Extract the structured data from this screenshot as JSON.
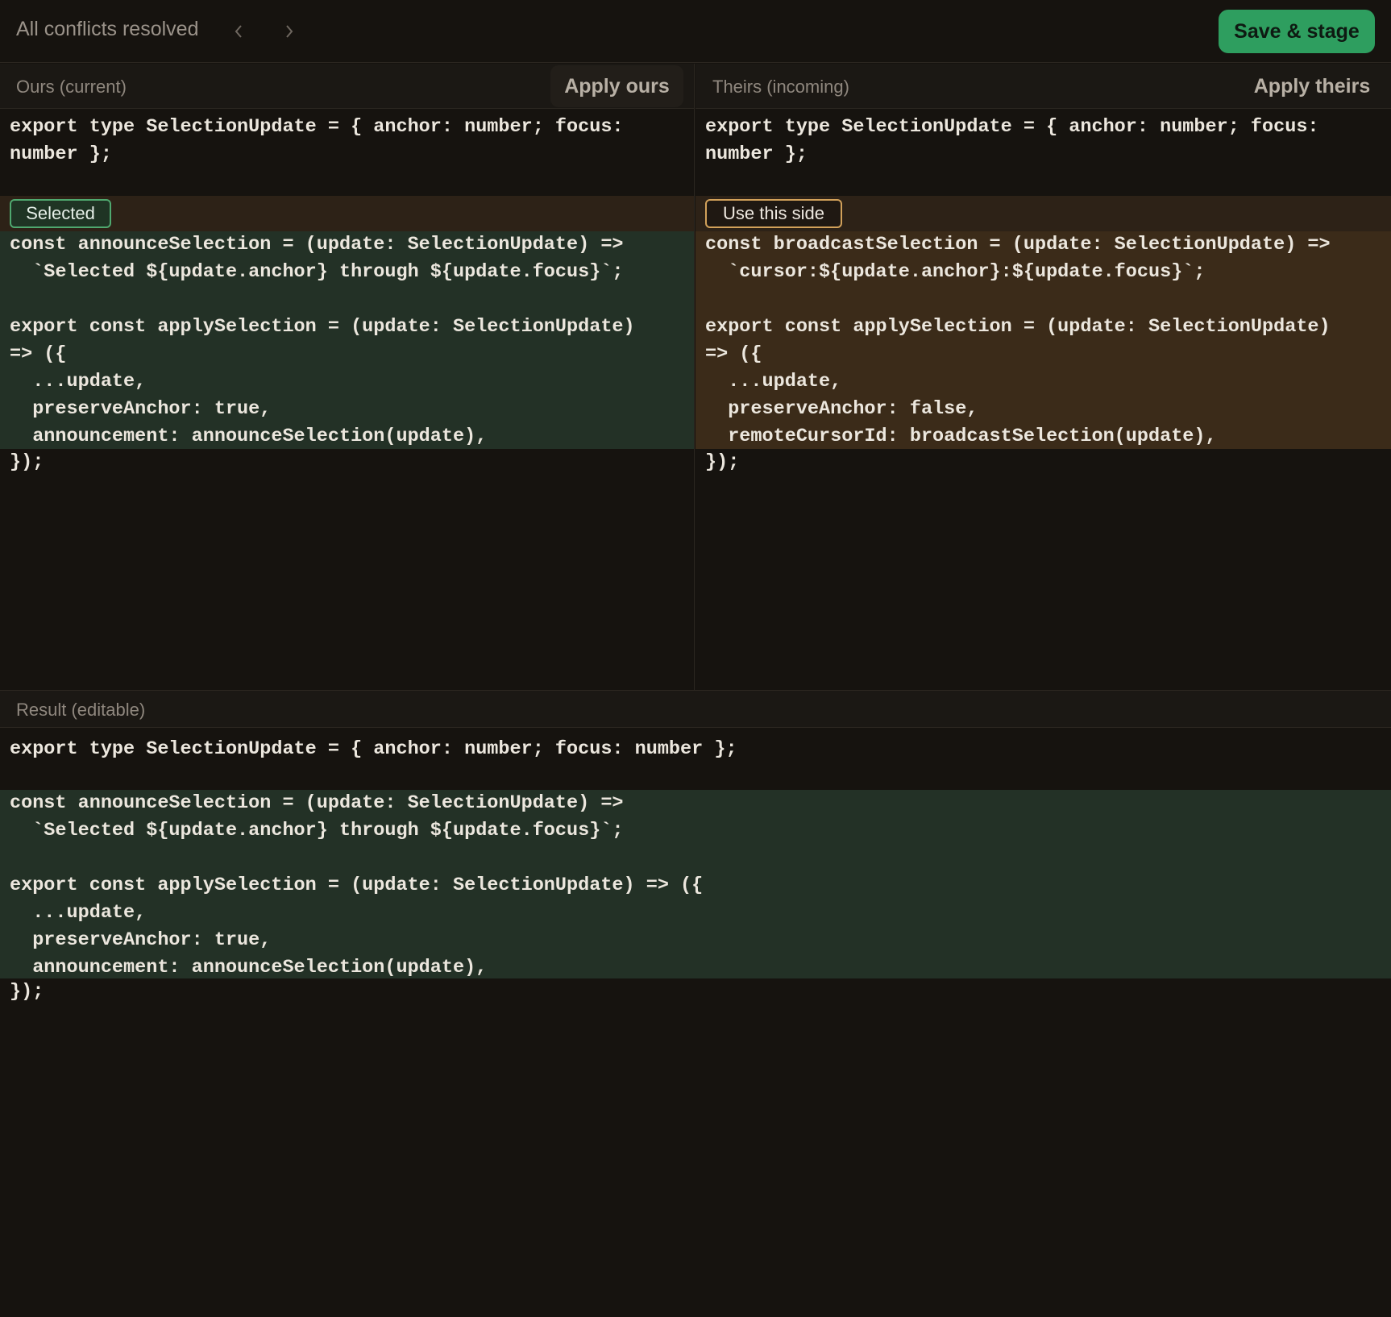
{
  "toolbar": {
    "status": "All conflicts resolved",
    "prev_icon": "chevron-left-icon",
    "next_icon": "chevron-right-icon",
    "save_label": "Save & stage"
  },
  "ours": {
    "title": "Ours (current)",
    "apply_label": "Apply ours",
    "common_code": "export type SelectionUpdate = { anchor: number; focus:\nnumber };",
    "tag_label": "Selected",
    "conflict_code": "const announceSelection = (update: SelectionUpdate) =>\n  `Selected ${update.anchor} through ${update.focus}`;\n\nexport const applySelection = (update: SelectionUpdate)\n=> ({\n  ...update,\n  preserveAnchor: true,\n  announcement: announceSelection(update),",
    "after_code": "});"
  },
  "theirs": {
    "title": "Theirs (incoming)",
    "apply_label": "Apply theirs",
    "common_code": "export type SelectionUpdate = { anchor: number; focus:\nnumber };",
    "tag_label": "Use this side",
    "conflict_code": "const broadcastSelection = (update: SelectionUpdate) =>\n  `cursor:${update.anchor}:${update.focus}`;\n\nexport const applySelection = (update: SelectionUpdate)\n=> ({\n  ...update,\n  preserveAnchor: false,\n  remoteCursorId: broadcastSelection(update),",
    "after_code": "});"
  },
  "result": {
    "title": "Result (editable)",
    "common_code": "export type SelectionUpdate = { anchor: number; focus: number };",
    "resolved_code": "const announceSelection = (update: SelectionUpdate) =>\n  `Selected ${update.anchor} through ${update.focus}`;\n\nexport const applySelection = (update: SelectionUpdate) => ({\n  ...update,\n  preserveAnchor: true,\n  announcement: announceSelection(update),",
    "after_code": "});"
  },
  "colors": {
    "accent_green": "#2e9e5f",
    "ours_highlight": "#233126",
    "theirs_highlight": "#3b2b19",
    "theirs_border": "#d2a15a"
  }
}
